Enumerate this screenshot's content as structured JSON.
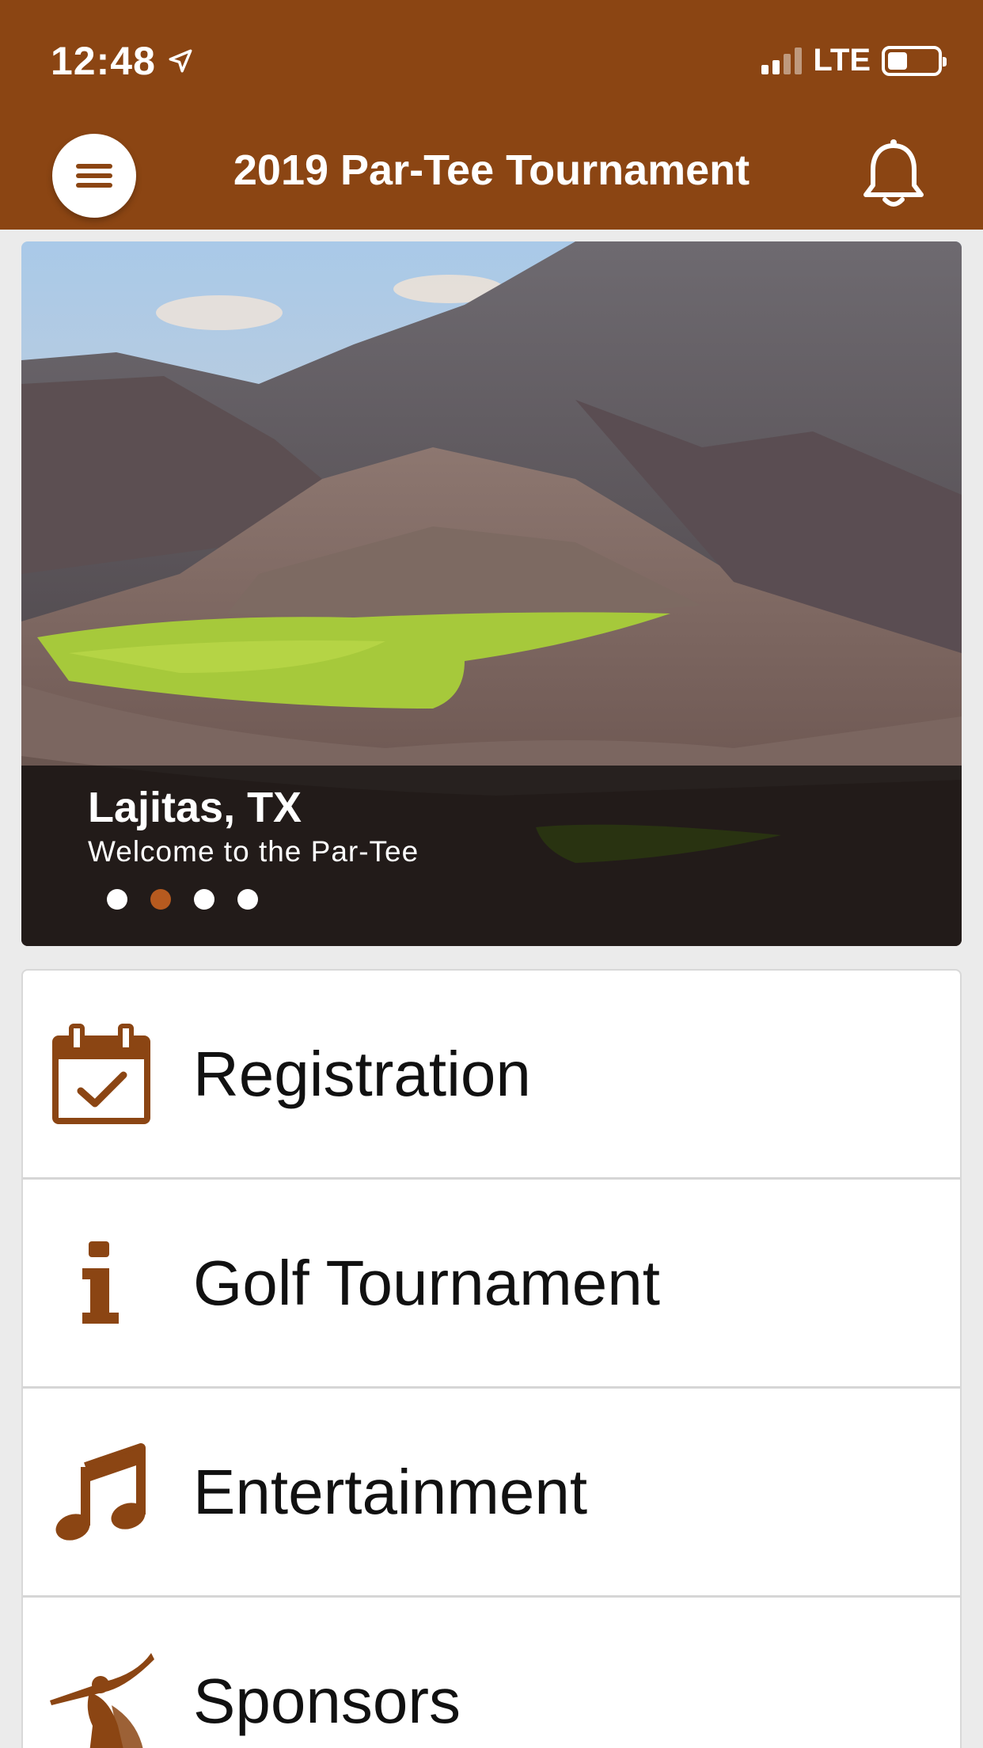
{
  "status_bar": {
    "time": "12:48",
    "network": "LTE"
  },
  "header": {
    "title": "2019 Par-Tee Tournament"
  },
  "hero": {
    "title": "Lajitas, TX",
    "subtitle": "Welcome to the Par-Tee",
    "slides_total": 4,
    "active_slide": 2
  },
  "menu": {
    "items": [
      {
        "label": "Registration",
        "icon": "calendar-check-icon"
      },
      {
        "label": "Golf Tournament",
        "icon": "info-icon"
      },
      {
        "label": "Entertainment",
        "icon": "music-note-icon"
      },
      {
        "label": "Sponsors",
        "icon": "horn-figure-icon"
      }
    ]
  },
  "colors": {
    "brand": "#8b4513",
    "accent": "#b65a1f",
    "background": "#ebebeb"
  }
}
